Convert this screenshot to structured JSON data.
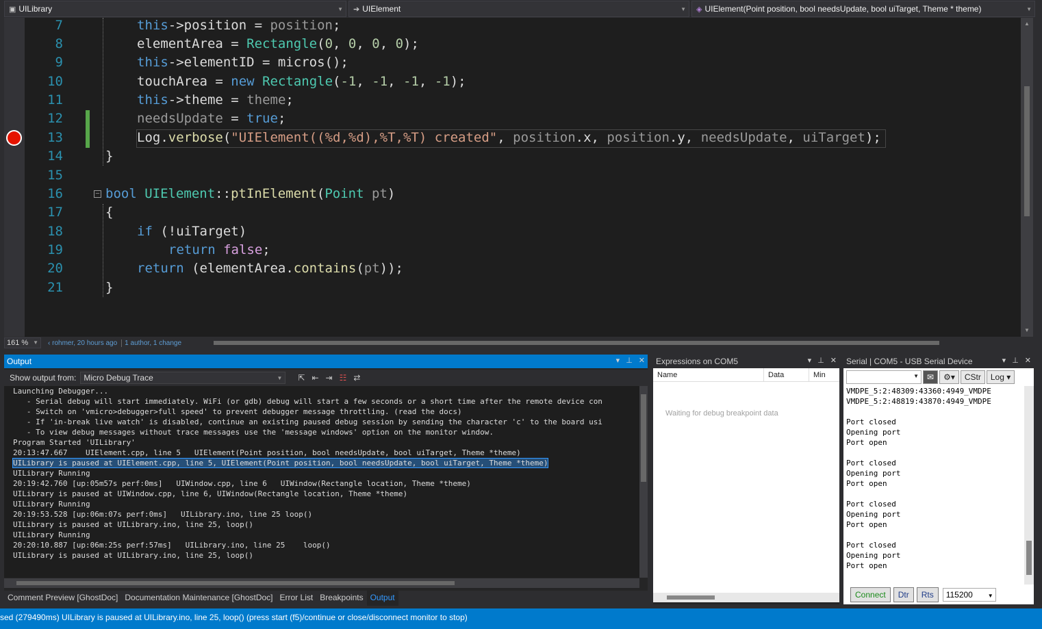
{
  "nav": {
    "project": "UILibrary",
    "class": "UIElement",
    "member": "UIElement(Point position, bool needsUpdate, bool uiTarget, Theme * theme)"
  },
  "editor": {
    "zoom": "161 %",
    "blame_author": "rohmer, 20 hours ago",
    "blame_changes": "1 author, 1 change",
    "line_numbers": [
      "7",
      "8",
      "9",
      "10",
      "11",
      "12",
      "13",
      "14",
      "15",
      "16",
      "17",
      "18",
      "19",
      "20",
      "21"
    ],
    "breakpoint_line": "13",
    "code_text": [
      "this->position = position;",
      "elementArea = Rectangle(0, 0, 0, 0);",
      "this->elementID = micros();",
      "touchArea = new Rectangle(-1, -1, -1, -1);",
      "this->theme = theme;",
      "needsUpdate = true;",
      "Log.verbose(\"UIElement((%d,%d),%T,%T) created\", position.x, position.y, needsUpdate, uiTarget);",
      "}",
      "",
      "bool UIElement::ptInElement(Point pt)",
      "{",
      "if (!uiTarget)",
      "return false;",
      "return (elementArea.contains(pt));",
      "}"
    ]
  },
  "output": {
    "title": "Output",
    "show_from_label": "Show output from:",
    "source": "Micro Debug Trace",
    "lines": [
      "Launching Debugger...",
      "   - Serial debug will start immediately. WiFi (or gdb) debug will start a few seconds or a short time after the remote device con",
      "   - Switch on 'vmicro>debugger>full speed' to prevent debugger message throttling. (read the docs)",
      "   - If 'in-break live watch' is disabled, continue an existing paused debug session by sending the character 'c' to the board usi",
      "   - To view debug messages without trace messages use the 'message windows' option on the monitor window.",
      "Program Started 'UILibrary'",
      "20:13:47.667    UIElement.cpp, line 5   UIElement(Point position, bool needsUpdate, bool uiTarget, Theme *theme)",
      "UILibrary is paused at UIElement.cpp, line 5, UIElement(Point position, bool needsUpdate, bool uiTarget, Theme *theme)",
      "UILibrary Running",
      "20:19:42.760 [up:05m57s perf:0ms]   UIWindow.cpp, line 6   UIWindow(Rectangle location, Theme *theme)",
      "UILibrary is paused at UIWindow.cpp, line 6, UIWindow(Rectangle location, Theme *theme)",
      "UILibrary Running",
      "20:19:53.528 [up:06m:07s perf:0ms]   UILibrary.ino, line 25 loop()",
      "UILibrary is paused at UILibrary.ino, line 25, loop()",
      "UILibrary Running",
      "20:20:10.887 [up:06m:25s perf:57ms]   UILibrary.ino, line 25    loop()",
      "UILibrary is paused at UILibrary.ino, line 25, loop()"
    ],
    "selected_line_index": 7
  },
  "bottom_tabs": [
    "Comment Preview [GhostDoc]",
    "Documentation Maintenance [GhostDoc]",
    "Error List",
    "Breakpoints",
    "Output"
  ],
  "expressions": {
    "title": "Expressions on COM5",
    "columns": [
      "Name",
      "Data",
      "Min"
    ],
    "empty_text": "Waiting for debug breakpoint data"
  },
  "serial": {
    "title": "Serial | COM5  - USB Serial Device",
    "cstr_label": "CStr",
    "log_label": "Log",
    "lines": [
      "VMDPE_5:2:48309:43360:4949_VMDPE",
      "VMDPE_5:2:48819:43870:4949_VMDPE",
      "",
      "Port closed",
      "Opening port",
      "Port open",
      "",
      "Port closed",
      "Opening port",
      "Port open",
      "",
      "Port closed",
      "Opening port",
      "Port open",
      "",
      "Port closed",
      "Opening port",
      "Port open"
    ],
    "connect_label": "Connect",
    "dtr_label": "Dtr",
    "rts_label": "Rts",
    "baud": "115200"
  },
  "status_bar": {
    "text": "sed (279490ms) UILibrary is paused at UILibrary.ino, line 25, loop() (press start (f5)/continue or close/disconnect monitor to stop)"
  },
  "colors": {
    "accent": "#007acc",
    "editor_bg": "#1e1e1e",
    "breakpoint": "#e51400",
    "change_bar": "#57a64a"
  }
}
